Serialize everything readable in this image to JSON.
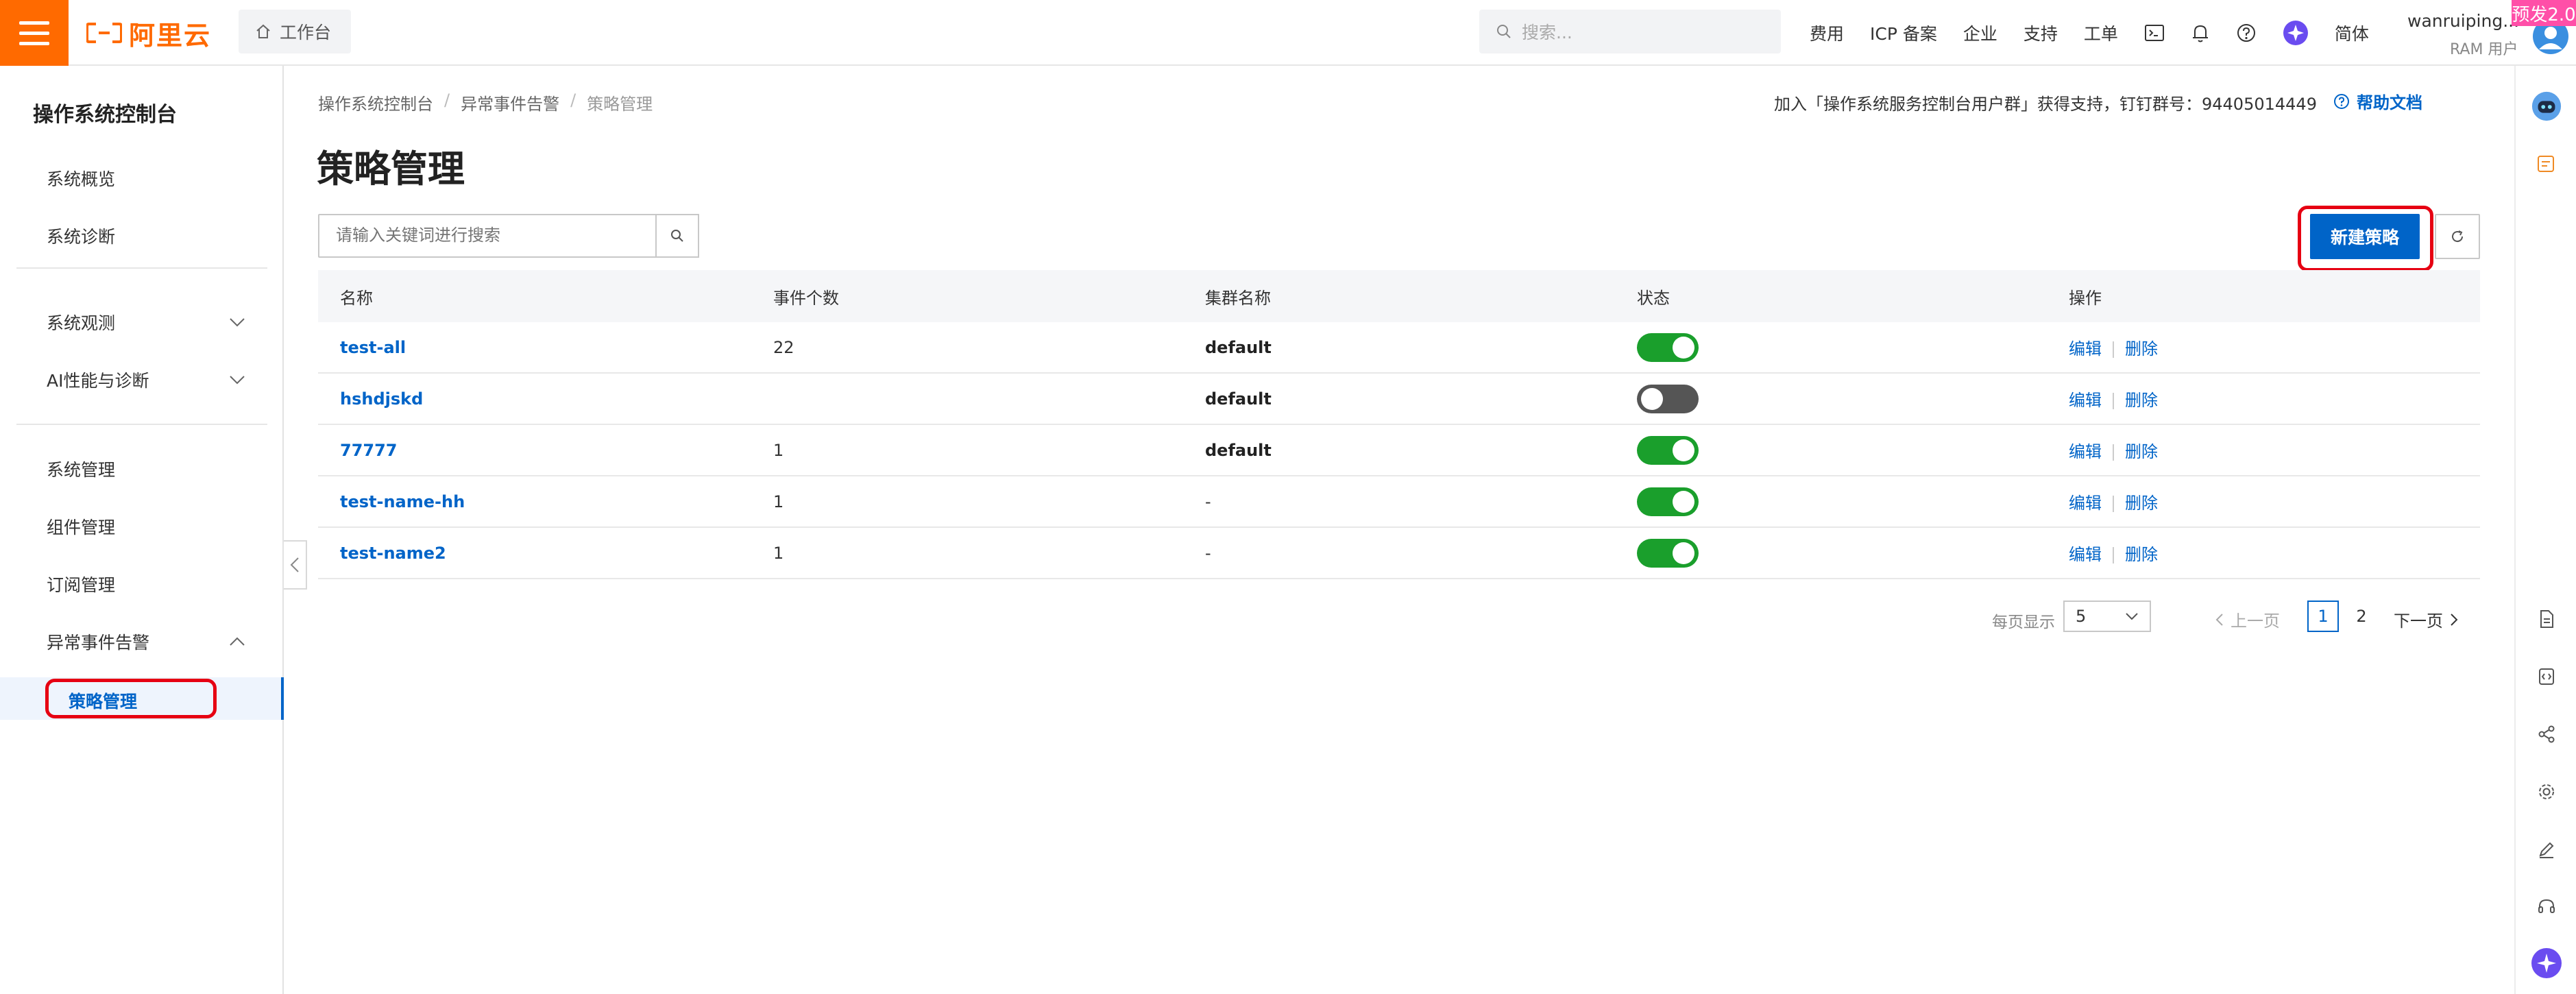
{
  "topbar": {
    "logo_text": "阿里云",
    "workbench_label": "工作台",
    "search_placeholder": "搜索...",
    "nav": [
      "费用",
      "ICP 备案",
      "企业",
      "支持",
      "工单"
    ],
    "lang": "简体",
    "user_name": "wanruiping...",
    "user_role": "RAM 用户",
    "preview_badge": "预发2.0"
  },
  "sidebar": {
    "title": "操作系统控制台",
    "items": [
      {
        "label": "系统概览"
      },
      {
        "label": "系统诊断"
      },
      {
        "label": "系统观测"
      },
      {
        "label": "AI性能与诊断"
      },
      {
        "label": "系统管理"
      },
      {
        "label": "组件管理"
      },
      {
        "label": "订阅管理"
      },
      {
        "label": "异常事件告警"
      },
      {
        "label": "策略管理"
      }
    ]
  },
  "breadcrumb": [
    "操作系统控制台",
    "异常事件告警",
    "策略管理"
  ],
  "support": {
    "join_text": "加入「操作系统服务控制台用户群」获得支持，钉钉群号：94405014449",
    "help_label": "帮助文档"
  },
  "page_title": "策略管理",
  "search": {
    "placeholder": "请输入关键词进行搜索"
  },
  "actions": {
    "new_label": "新建策略"
  },
  "table": {
    "headers": [
      "名称",
      "事件个数",
      "集群名称",
      "状态",
      "操作"
    ],
    "rows": [
      {
        "name": "test-all",
        "count": "22",
        "cluster": "default",
        "enabled": true,
        "edit": "编辑",
        "delete": "删除"
      },
      {
        "name": "hshdjskd",
        "count": "",
        "cluster": "default",
        "enabled": false,
        "edit": "编辑",
        "delete": "删除"
      },
      {
        "name": "77777",
        "count": "1",
        "cluster": "default",
        "enabled": true,
        "edit": "编辑",
        "delete": "删除"
      },
      {
        "name": "test-name-hh",
        "count": "1",
        "cluster": "-",
        "enabled": true,
        "edit": "编辑",
        "delete": "删除"
      },
      {
        "name": "test-name2",
        "count": "1",
        "cluster": "-",
        "enabled": true,
        "edit": "编辑",
        "delete": "删除"
      }
    ]
  },
  "pagination": {
    "per_page_label": "每页显示",
    "per_page_value": "5",
    "prev_label": "上一页",
    "next_label": "下一页",
    "pages": [
      "1",
      "2"
    ],
    "current_page": "1"
  },
  "colors": {
    "brand": "#ff6a00",
    "primary": "#0064c8",
    "switch_on": "#1a9f2c",
    "highlight": "#e60012"
  }
}
